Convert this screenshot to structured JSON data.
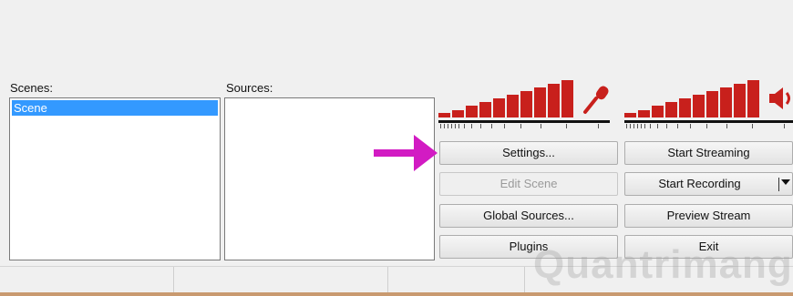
{
  "scenes": {
    "label": "Scenes:",
    "items": [
      "Scene"
    ]
  },
  "sources": {
    "label": "Sources:"
  },
  "buttons": {
    "settings": "Settings...",
    "edit_scene": "Edit Scene",
    "global_sources": "Global Sources...",
    "plugins": "Plugins",
    "start_streaming": "Start Streaming",
    "start_recording": "Start Recording",
    "preview_stream": "Preview Stream",
    "exit": "Exit"
  },
  "icons": {
    "mic": "microphone-icon",
    "speaker": "speaker-icon",
    "arrow": "arrow-right-icon",
    "dropdown": "caret-down-icon"
  },
  "colors": {
    "meter": "#c8201c",
    "selection": "#3399ff",
    "arrow": "#d21bc3"
  },
  "watermark": {
    "text": "Quantrimang"
  }
}
